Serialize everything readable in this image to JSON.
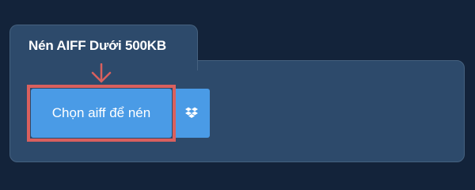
{
  "tab": {
    "title": "Nén AIFF Dưới 500KB"
  },
  "upload": {
    "choose_label": "Chọn aiff để nén",
    "dropbox_icon": "dropbox-icon"
  },
  "colors": {
    "background": "#13233a",
    "panel": "#2d4a6b",
    "button": "#4a9be6",
    "highlight": "#d9605e"
  }
}
